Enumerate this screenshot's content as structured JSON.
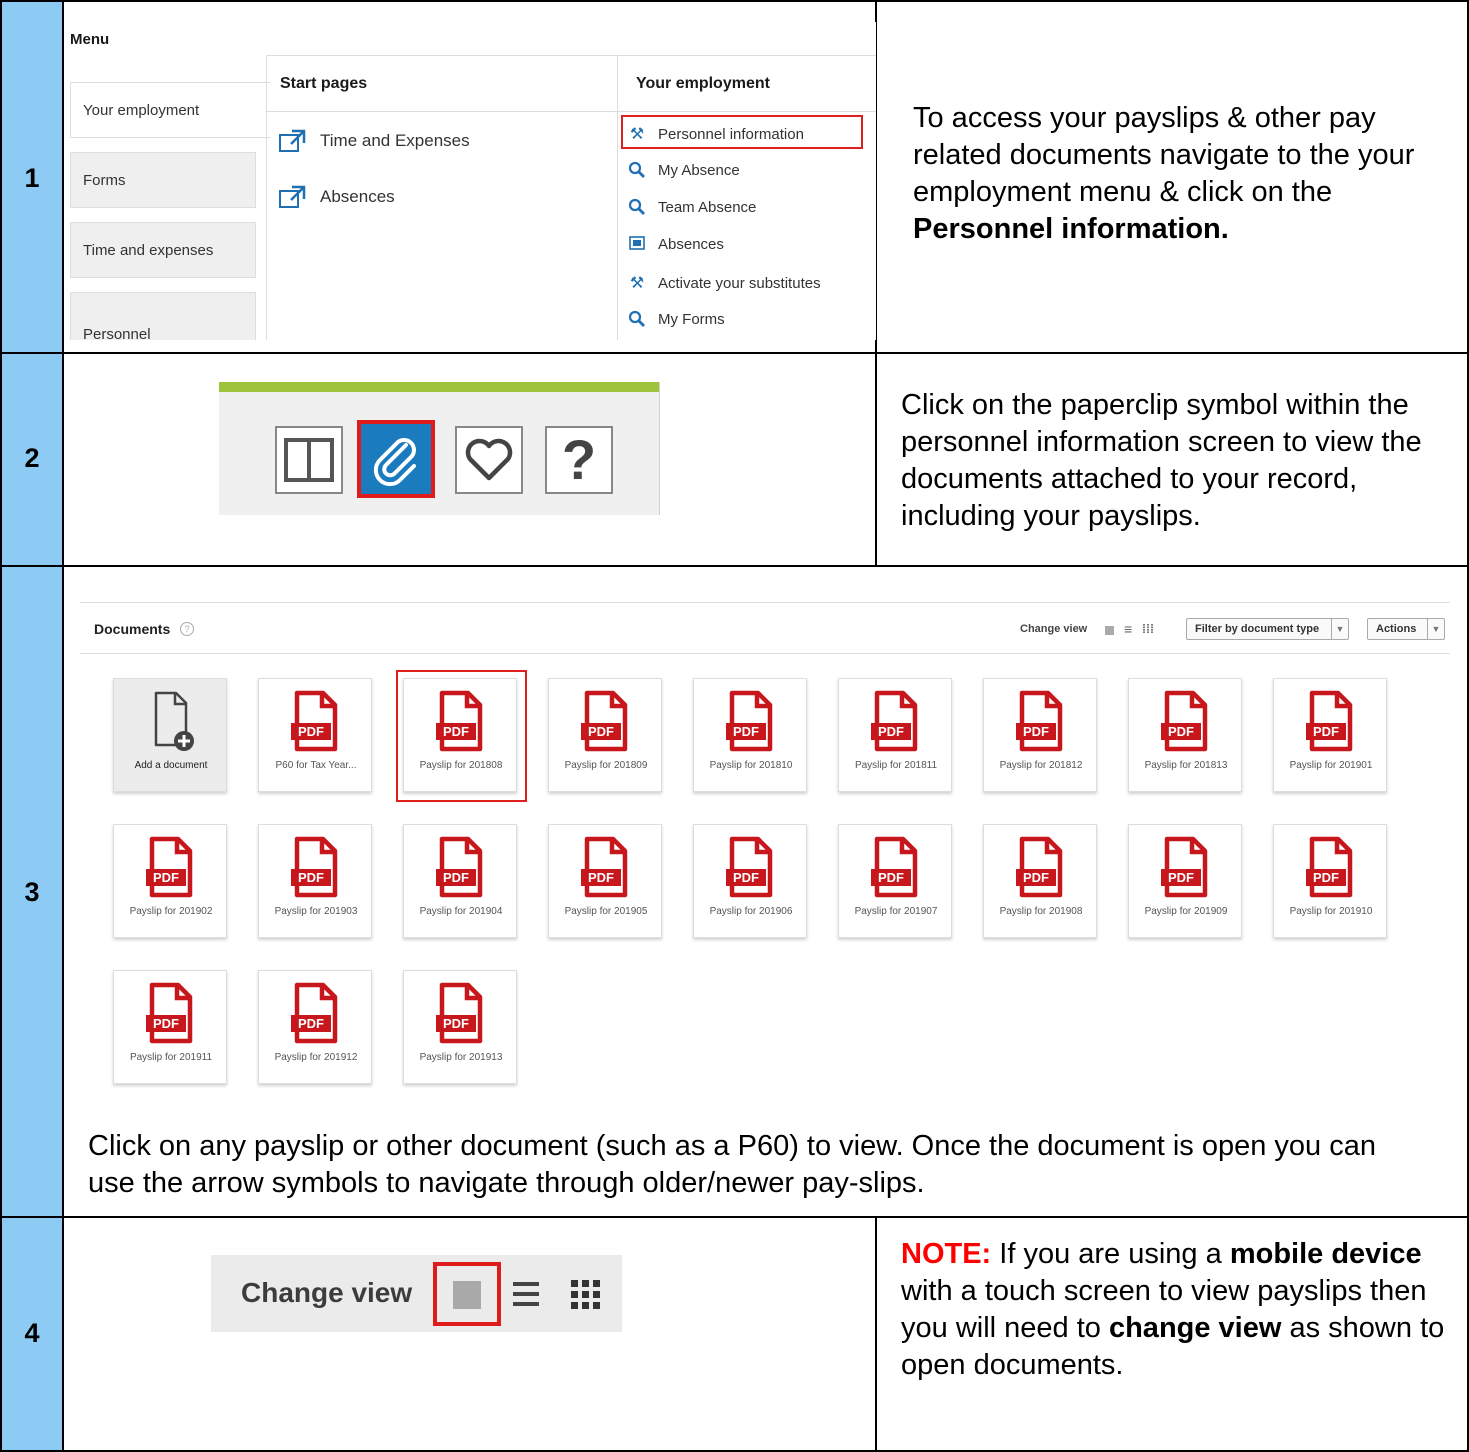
{
  "steps": [
    {
      "number": "1"
    },
    {
      "number": "2"
    },
    {
      "number": "3"
    },
    {
      "number": "4"
    }
  ],
  "section1": {
    "menu_title": "Menu",
    "left_items": [
      "Your employment",
      "Forms",
      "Time and expenses",
      "Personnel"
    ],
    "start_pages_heading": "Start pages",
    "start_pages": [
      "Time and Expenses",
      "Absences"
    ],
    "your_employment_heading": "Your employment",
    "your_employment_items": [
      {
        "label": "Personnel information",
        "icon": "tools-icon"
      },
      {
        "label": "My Absence",
        "icon": "search-icon"
      },
      {
        "label": "Team Absence",
        "icon": "search-icon"
      },
      {
        "label": "Absences",
        "icon": "form-icon"
      },
      {
        "label": "Activate your substitutes",
        "icon": "tools-icon"
      },
      {
        "label": "My Forms",
        "icon": "search-icon"
      }
    ],
    "instruction_pre": "To access your payslips & other pay related documents navigate to the your employment menu & click on the ",
    "instruction_bold": "Personnel information."
  },
  "section2": {
    "buttons": [
      "split-view-icon",
      "paperclip-icon",
      "heart-icon",
      "help-icon"
    ],
    "help_glyph": "?",
    "instruction": "Click on the paperclip symbol within the personnel information screen to view the documents attached to your record, including your payslips."
  },
  "section3": {
    "documents_title": "Documents",
    "help_glyph": "?",
    "change_view_label": "Change view",
    "filter_label": "Filter by document type",
    "actions_label": "Actions",
    "pdf_badge": "PDF",
    "tiles": [
      "Add a document",
      "P60 for Tax Year...",
      "Payslip for 201808",
      "Payslip for 201809",
      "Payslip for 201810",
      "Payslip for 201811",
      "Payslip for 201812",
      "Payslip for 201813",
      "Payslip for 201901",
      "Payslip for 201902",
      "Payslip for 201903",
      "Payslip for 201904",
      "Payslip for 201905",
      "Payslip for 201906",
      "Payslip for 201907",
      "Payslip for 201908",
      "Payslip for 201909",
      "Payslip for 201910",
      "Payslip for 201911",
      "Payslip for 201912",
      "Payslip for 201913"
    ],
    "instruction": "Click on any payslip or other document (such as a P60) to view. Once the document is open you can use the arrow symbols to navigate through older/newer pay-slips."
  },
  "section4": {
    "change_view_label": "Change view",
    "note_label": "NOTE:",
    "text_1": " If you are using a ",
    "bold_1": "mobile device",
    "text_2": " with a touch screen to view payslips then you will need to ",
    "bold_2": "change view",
    "text_3": " as shown to open documents."
  },
  "colors": {
    "step_column": "#8ecbf4",
    "highlight_red": "#e0201e",
    "pdf_red": "#c8161d",
    "note_red": "#ff0000",
    "toolbar_green": "#9dc43a",
    "clip_blue": "#1b7bbf"
  }
}
